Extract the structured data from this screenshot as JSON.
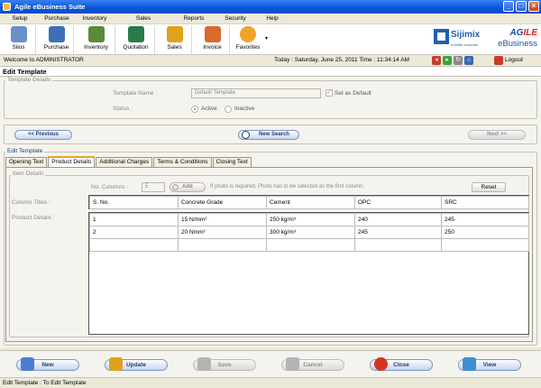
{
  "window": {
    "title": "Agile eBusiness Suite"
  },
  "menu": [
    "Setup",
    "Purchase",
    "Inventory",
    "Sales",
    "Reports",
    "Security",
    "Help"
  ],
  "toolbar": {
    "buttons": [
      {
        "label": "Silos",
        "icon": "silos-icon",
        "color": "#6b8fc9"
      },
      {
        "label": "Purchase",
        "icon": "truck-icon",
        "color": "#3d6fb7"
      },
      {
        "label": "Inventory",
        "icon": "inventory-icon",
        "color": "#5b8a3a"
      },
      {
        "label": "Quotation",
        "icon": "quotation-icon",
        "color": "#2b7a4b"
      },
      {
        "label": "Sales",
        "icon": "sales-icon",
        "color": "#e0a21b"
      },
      {
        "label": "Invoice",
        "icon": "invoice-icon",
        "color": "#d86a2a"
      },
      {
        "label": "Favorites",
        "icon": "star-icon",
        "color": "#f0a32a"
      }
    ],
    "favorites_arrow": "▾"
  },
  "logos": {
    "sijimix_name": "Sijimix",
    "sijimix_tag": "a better concrete",
    "agile_l1_a": "AG",
    "agile_l1_b": "ILE",
    "agile_l2": "eBusiness"
  },
  "status": {
    "welcome": "Welcome to ADMINISTRATOR",
    "today": "Today : Saturday, June 25, 2011  Time : 11:34:14 AM",
    "logout": "Logout"
  },
  "page_title": "Edit Template",
  "template_details": {
    "legend": "Template Details",
    "name_label": "Template Name :",
    "name_value": "Default Template",
    "set_default_label": "Set as Default",
    "status_label": "Status :",
    "active_label": "Active",
    "inactive_label": "Inactive"
  },
  "nav": {
    "previous": "<< Previous",
    "new_search": "New Search",
    "next": "Next >>"
  },
  "edit_template": {
    "legend": "Edit Template",
    "tabs": [
      "Opening Text",
      "Product Details",
      "Additional Charges",
      "Terms & Conditions",
      "Closing Text"
    ],
    "active_tab": "Product Details",
    "item_details_legend": "Item Details",
    "no_columns_label": "No. Columns :",
    "no_columns_value": "5",
    "add_label": "Add",
    "photo_hint": "If photo is required, Photo has to be selected as the first column.",
    "reset_label": "Reset",
    "column_titles_label": "Column Titles :",
    "product_details_label": "Product Details :",
    "columns": [
      "S. No.",
      "Concrete Grade",
      "Cement",
      "OPC",
      "SRC"
    ],
    "rows": [
      [
        "1",
        "15 N/mm²",
        "250 kg/m³",
        "240",
        "245"
      ],
      [
        "2",
        "20 Nmm²",
        "300 kg/m³",
        "245",
        "250"
      ],
      [
        "",
        "",
        "",
        "",
        ""
      ]
    ]
  },
  "actions": [
    {
      "label": "New",
      "icon": "new-icon",
      "enabled": true
    },
    {
      "label": "Update",
      "icon": "update-icon",
      "enabled": true
    },
    {
      "label": "Save",
      "icon": "save-icon",
      "enabled": false
    },
    {
      "label": "Cancel",
      "icon": "cancel-icon",
      "enabled": false
    },
    {
      "label": "Close",
      "icon": "close-icon",
      "enabled": true
    },
    {
      "label": "View",
      "icon": "view-icon",
      "enabled": true
    }
  ],
  "statusbar": "Edit Template : To Edit Template"
}
